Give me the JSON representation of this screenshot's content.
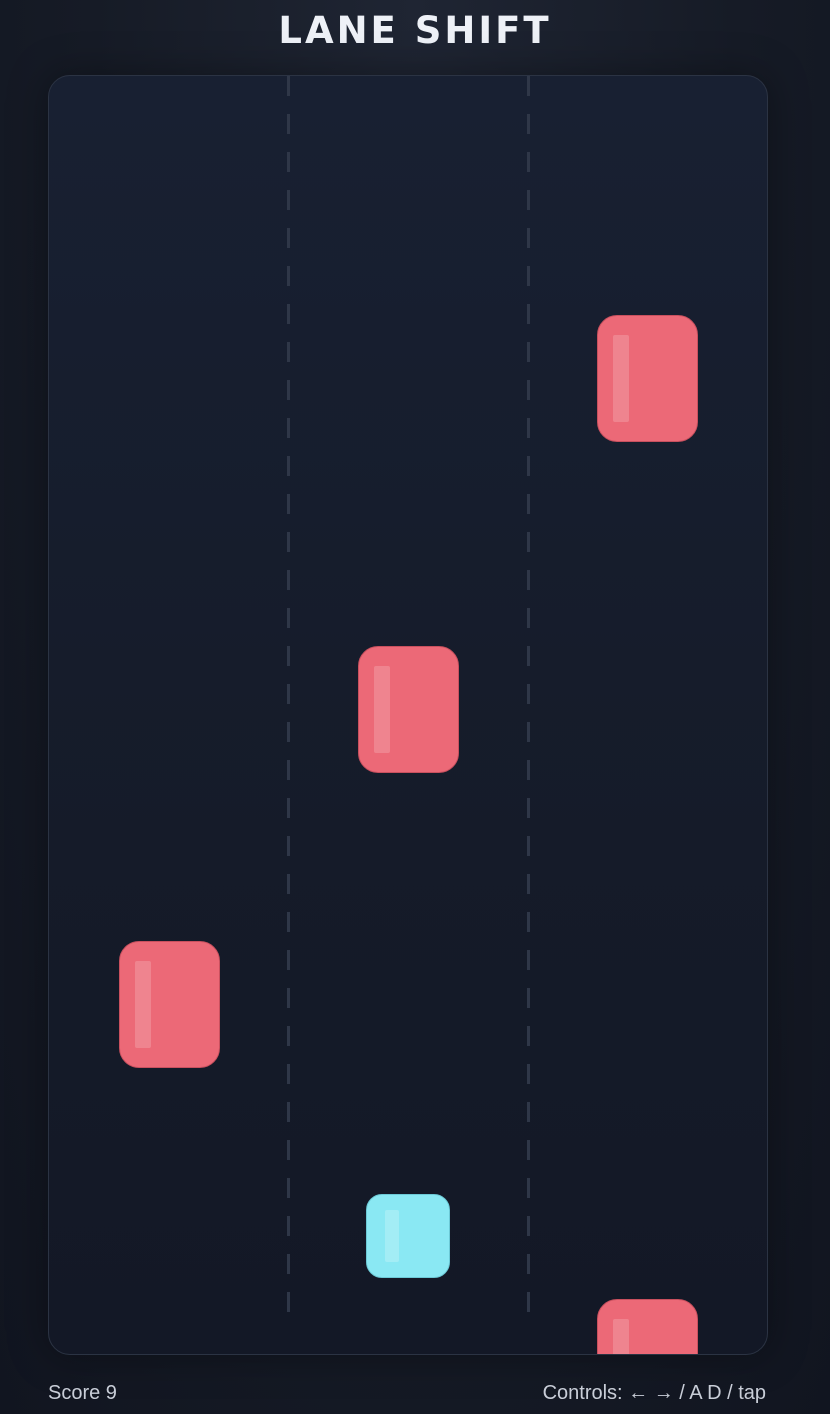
{
  "title": "LANE SHIFT",
  "score": {
    "text": "Score 9",
    "value": 9
  },
  "controls_hint": "Controls: ← → / A D / tap",
  "game": {
    "lanes": 3,
    "player": {
      "lane": 2,
      "color": "#8ae8f3"
    },
    "obstacles": [
      {
        "lane": 3,
        "color": "#ec6977"
      },
      {
        "lane": 2,
        "color": "#ec6977"
      },
      {
        "lane": 1,
        "color": "#ec6977"
      },
      {
        "lane": 3,
        "color": "#ec6977"
      }
    ]
  },
  "colors": {
    "background": "#161b26",
    "board": "#151b29",
    "obstacle": "#ec6977",
    "player": "#8ae8f3",
    "text": "#eef1f7"
  }
}
